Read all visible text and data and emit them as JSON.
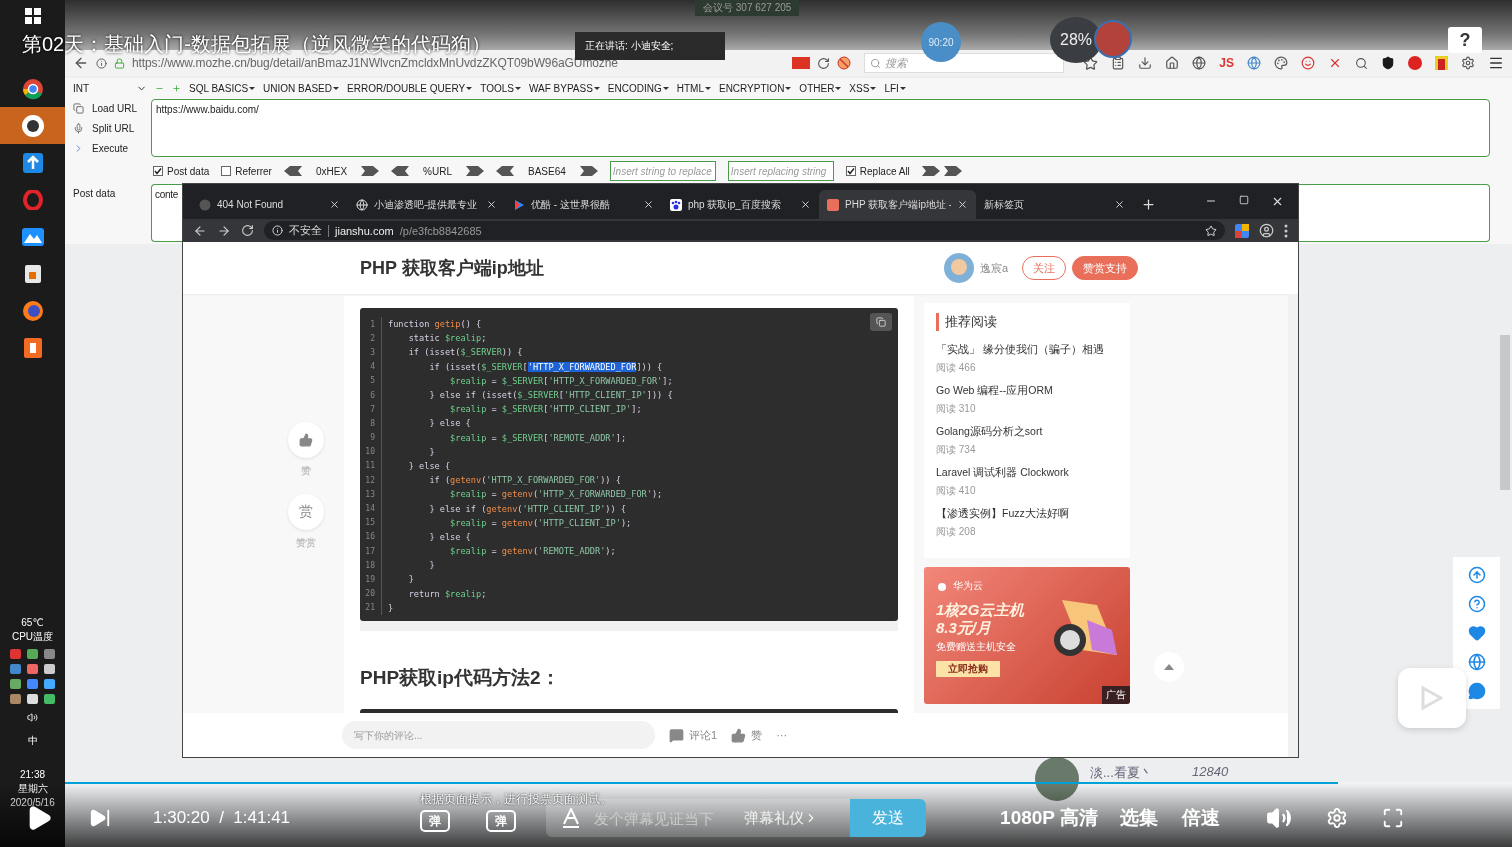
{
  "video": {
    "title": "第02天：基础入门-数据包拓展（逆风微笑的代码狗）",
    "meeting": "会议号 307 627 205",
    "speaking": "正在讲话: 小迪安全;",
    "timer": "90:20",
    "cpu_load": "28%",
    "help": "?",
    "subtitle": "根据页面提示，进行投票页面测试。",
    "time": "1:30:20  /  1:41:41",
    "progress": {
      "level": 0.88
    },
    "danmaku_toggles": [
      "弹",
      "弹"
    ],
    "danmaku_placeholder": "发个弹幕见证当下",
    "danmaku_etiquette": "弹幕礼仪",
    "send": "发送",
    "quality": "1080P 高清",
    "episodes": "选集",
    "speed": "倍速"
  },
  "taskbar": {
    "apps": [
      {
        "kind": "windows",
        "selected": false
      },
      {
        "kind": "chrome",
        "selected": false
      },
      {
        "kind": "avatar",
        "selected": true
      },
      {
        "kind": "arrow",
        "selected": false
      },
      {
        "kind": "opera",
        "selected": false
      },
      {
        "kind": "mountain",
        "selected": false
      },
      {
        "kind": "cup",
        "selected": false
      },
      {
        "kind": "firefox",
        "selected": false
      },
      {
        "kind": "tile",
        "selected": false
      }
    ],
    "temperature": "65℃",
    "temperature_label": "CPU温度",
    "ime": "中",
    "time": "21:38",
    "weekday": "星期六",
    "date": "2020/5/16"
  },
  "firefox": {
    "url": "https://www.mozhe.cn/bug/detail/anBmazJ1NWlvcnZmcldxMnUvdzZKQT09bW96aGUmozhe",
    "search_placeholder": "搜索",
    "js_label": "JS",
    "hackbar": {
      "select": "INT",
      "menus": [
        "SQL BASICS",
        "UNION BASED",
        "ERROR/DOUBLE QUERY",
        "TOOLS",
        "WAF BYPASS",
        "ENCODING",
        "HTML",
        "ENCRYPTION",
        "OTHER",
        "XSS",
        "LFI"
      ],
      "actions": [
        "Load URL",
        "Split URL",
        "Execute"
      ],
      "url_value": "https://www.baidu.com/",
      "options": [
        {
          "kind": "checkbox",
          "label": "Post data",
          "checked": true
        },
        {
          "kind": "checkbox",
          "label": "Referrer",
          "checked": false
        },
        {
          "kind": "encoder",
          "label": "0xHEX"
        },
        {
          "kind": "encoder",
          "label": "%URL"
        },
        {
          "kind": "encoder",
          "label": "BASE64"
        },
        {
          "kind": "field",
          "placeholder": "Insert string to replace"
        },
        {
          "kind": "field",
          "placeholder": "Insert replacing string"
        },
        {
          "kind": "checkbox",
          "label": "Replace All",
          "checked": true
        },
        {
          "kind": "arrows"
        }
      ],
      "post_label": "Post data",
      "post_value": "conte"
    },
    "behind_user": "淡...看夏丶",
    "behind_count": "12840"
  },
  "chrome": {
    "tabs": [
      {
        "kind": "blank",
        "title": "404 Not Found",
        "selected": false
      },
      {
        "kind": "globe",
        "title": "小迪渗透吧-提供最专业",
        "selected": false
      },
      {
        "kind": "play",
        "title": "优酷 - 这世界很酷",
        "selected": false
      },
      {
        "kind": "paw",
        "title": "php 获取ip_百度搜索",
        "selected": false
      },
      {
        "kind": "square",
        "title": "PHP 获取客户端ip地址 -",
        "selected": true
      },
      {
        "kind": "none",
        "title": "新标签页",
        "selected": false
      }
    ],
    "not_secure": "不安全",
    "host": "jianshu.com",
    "path": "/p/e3fcb8842685"
  },
  "article": {
    "title": "PHP 获取客户端ip地址",
    "author": "逸宸a",
    "follow": "关注",
    "tip": "赞赏支持",
    "like_label": "赞",
    "reward_icon": "赏",
    "reward_label": "赞赏",
    "code": [
      {
        "number": "1",
        "tokens": [
          {
            "kind": "plain",
            "text": "function "
          },
          {
            "kind": "func",
            "text": "getip"
          },
          {
            "kind": "plain",
            "text": "() {"
          }
        ]
      },
      {
        "number": "2",
        "tokens": [
          {
            "kind": "plain",
            "text": "    static "
          },
          {
            "kind": "var",
            "text": "$realip"
          },
          {
            "kind": "plain",
            "text": ";"
          }
        ]
      },
      {
        "number": "3",
        "tokens": [
          {
            "kind": "plain",
            "text": "    if (isset("
          },
          {
            "kind": "var",
            "text": "$_SERVER"
          },
          {
            "kind": "plain",
            "text": ")) {"
          }
        ]
      },
      {
        "number": "4",
        "tokens": [
          {
            "kind": "plain",
            "text": "        if (isset("
          },
          {
            "kind": "var",
            "text": "$_SERVER"
          },
          {
            "kind": "plain",
            "text": "["
          },
          {
            "kind": "selected",
            "text": "'HTTP_X_FORWARDED_FOR"
          },
          {
            "kind": "plain",
            "text": "])) {"
          }
        ]
      },
      {
        "number": "5",
        "tokens": [
          {
            "kind": "var",
            "text": "            $realip"
          },
          {
            "kind": "plain",
            "text": " = "
          },
          {
            "kind": "var",
            "text": "$_SERVER"
          },
          {
            "kind": "plain",
            "text": "["
          },
          {
            "kind": "str",
            "text": "'HTTP_X_FORWARDED_FOR'"
          },
          {
            "kind": "plain",
            "text": "];"
          }
        ]
      },
      {
        "number": "6",
        "tokens": [
          {
            "kind": "plain",
            "text": "        } else if (isset("
          },
          {
            "kind": "var",
            "text": "$_SERVER"
          },
          {
            "kind": "plain",
            "text": "["
          },
          {
            "kind": "str",
            "text": "'HTTP_CLIENT_IP'"
          },
          {
            "kind": "plain",
            "text": "])) {"
          }
        ]
      },
      {
        "number": "7",
        "tokens": [
          {
            "kind": "var",
            "text": "            $realip"
          },
          {
            "kind": "plain",
            "text": " = "
          },
          {
            "kind": "var",
            "text": "$_SERVER"
          },
          {
            "kind": "plain",
            "text": "["
          },
          {
            "kind": "str",
            "text": "'HTTP_CLIENT_IP'"
          },
          {
            "kind": "plain",
            "text": "];"
          }
        ]
      },
      {
        "number": "8",
        "tokens": [
          {
            "kind": "plain",
            "text": "        } else {"
          }
        ]
      },
      {
        "number": "9",
        "tokens": [
          {
            "kind": "var",
            "text": "            $realip"
          },
          {
            "kind": "plain",
            "text": " = "
          },
          {
            "kind": "var",
            "text": "$_SERVER"
          },
          {
            "kind": "plain",
            "text": "["
          },
          {
            "kind": "str",
            "text": "'REMOTE_ADDR'"
          },
          {
            "kind": "plain",
            "text": "];"
          }
        ]
      },
      {
        "number": "10",
        "tokens": [
          {
            "kind": "plain",
            "text": "        }"
          }
        ]
      },
      {
        "number": "11",
        "tokens": [
          {
            "kind": "plain",
            "text": "    } else {"
          }
        ]
      },
      {
        "number": "12",
        "tokens": [
          {
            "kind": "plain",
            "text": "        if ("
          },
          {
            "kind": "func",
            "text": "getenv"
          },
          {
            "kind": "plain",
            "text": "("
          },
          {
            "kind": "str",
            "text": "'HTTP_X_FORWARDED_FOR'"
          },
          {
            "kind": "plain",
            "text": ")) {"
          }
        ]
      },
      {
        "number": "13",
        "tokens": [
          {
            "kind": "var",
            "text": "            $realip"
          },
          {
            "kind": "plain",
            "text": " = "
          },
          {
            "kind": "func",
            "text": "getenv"
          },
          {
            "kind": "plain",
            "text": "("
          },
          {
            "kind": "str",
            "text": "'HTTP_X_FORWARDED_FOR'"
          },
          {
            "kind": "plain",
            "text": ");"
          }
        ]
      },
      {
        "number": "14",
        "tokens": [
          {
            "kind": "plain",
            "text": "        } else if ("
          },
          {
            "kind": "func",
            "text": "getenv"
          },
          {
            "kind": "plain",
            "text": "("
          },
          {
            "kind": "str",
            "text": "'HTTP_CLIENT_IP'"
          },
          {
            "kind": "plain",
            "text": ")) {"
          }
        ]
      },
      {
        "number": "15",
        "tokens": [
          {
            "kind": "var",
            "text": "            $realip"
          },
          {
            "kind": "plain",
            "text": " = "
          },
          {
            "kind": "func",
            "text": "getenv"
          },
          {
            "kind": "plain",
            "text": "("
          },
          {
            "kind": "str",
            "text": "'HTTP_CLIENT_IP'"
          },
          {
            "kind": "plain",
            "text": ");"
          }
        ]
      },
      {
        "number": "16",
        "tokens": [
          {
            "kind": "plain",
            "text": "        } else {"
          }
        ]
      },
      {
        "number": "17",
        "tokens": [
          {
            "kind": "var",
            "text": "            $realip"
          },
          {
            "kind": "plain",
            "text": " = "
          },
          {
            "kind": "func",
            "text": "getenv"
          },
          {
            "kind": "plain",
            "text": "("
          },
          {
            "kind": "str",
            "text": "'REMOTE_ADDR'"
          },
          {
            "kind": "plain",
            "text": ");"
          }
        ]
      },
      {
        "number": "18",
        "tokens": [
          {
            "kind": "plain",
            "text": "        }"
          }
        ]
      },
      {
        "number": "19",
        "tokens": [
          {
            "kind": "plain",
            "text": "    }"
          }
        ]
      },
      {
        "number": "20",
        "tokens": [
          {
            "kind": "plain",
            "text": "    return "
          },
          {
            "kind": "var",
            "text": "$realip"
          },
          {
            "kind": "plain",
            "text": ";"
          }
        ]
      },
      {
        "number": "21",
        "tokens": [
          {
            "kind": "plain",
            "text": "}"
          }
        ]
      }
    ],
    "heading2": "PHP获取ip代码方法2：",
    "recommend_title": "推荐阅读",
    "recommended": [
      {
        "title": "「实战」 缘分使我们（骗子）相遇",
        "reads": "阅读 466"
      },
      {
        "title": "Go Web 编程--应用ORM",
        "reads": "阅读 310"
      },
      {
        "title": "Golang源码分析之sort",
        "reads": "阅读 734"
      },
      {
        "title": "Laravel 调试利器 Clockwork",
        "reads": "阅读 410"
      },
      {
        "title": "【渗透实例】Fuzz大法好啊",
        "reads": "阅读 208"
      }
    ],
    "ad": {
      "brand": "华为云",
      "headline": "1核2G云主机",
      "price": "8.3元/月",
      "sub": "免费赠送主机安全",
      "cta": "立即抢购",
      "tag": "广告"
    },
    "comment_placeholder": "写下你的评论...",
    "comment_count": "评论1",
    "like": "赞",
    "more": "···"
  }
}
